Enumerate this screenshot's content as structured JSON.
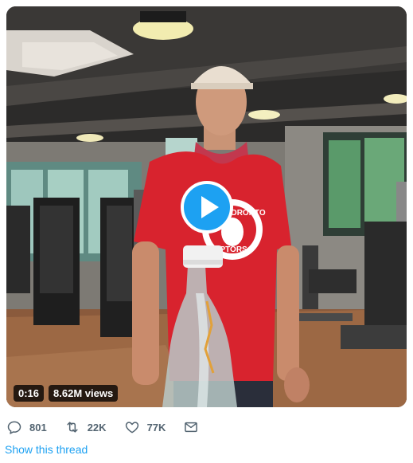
{
  "video": {
    "duration": "0:16",
    "views": "8.62M views",
    "shirt_text_top": "TORONTO",
    "shirt_text_bottom": "RAPTORS"
  },
  "actions": {
    "replies": "801",
    "retweets": "22K",
    "likes": "77K"
  },
  "show_thread": "Show this thread",
  "colors": {
    "accent": "#1da1f2",
    "icon_gray": "#536471"
  }
}
